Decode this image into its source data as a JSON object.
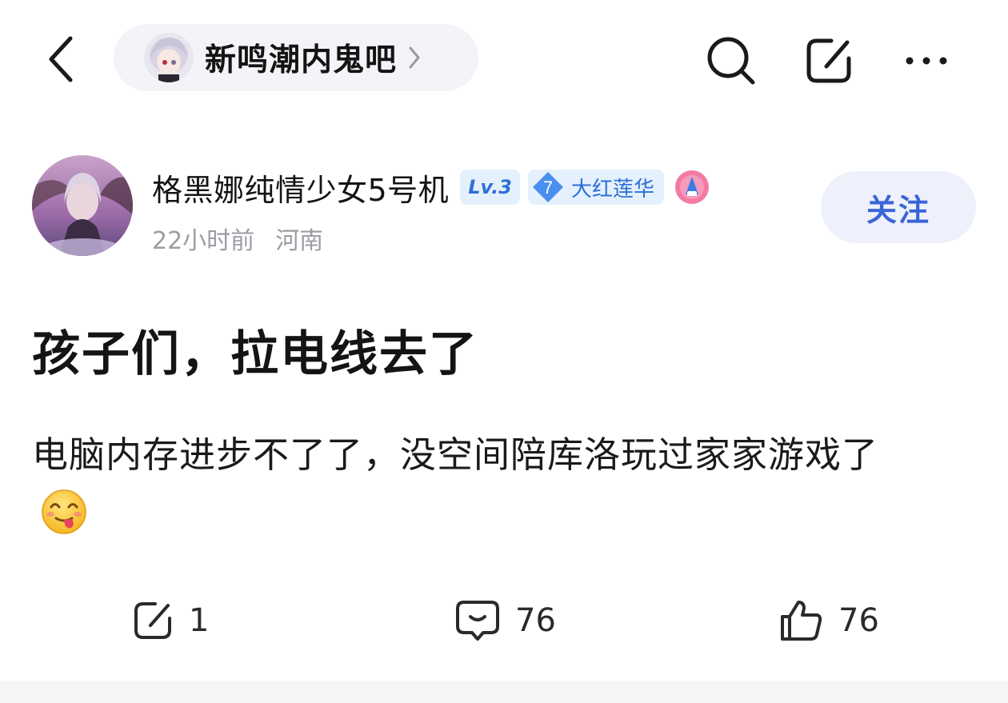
{
  "header": {
    "forum_name": "新鸣潮内鬼吧",
    "icons": [
      "back-arrow-icon",
      "search-icon",
      "share-icon",
      "more-icon"
    ]
  },
  "author": {
    "name": "格黑娜纯情少女5号机",
    "level": "Lv.3",
    "honor_level": "7",
    "honor_title": "大红莲华",
    "time": "22小时前",
    "location": "河南",
    "follow_label": "关注"
  },
  "post": {
    "title": "孩子们，拉电线去了",
    "body": "电脑内存进步不了了，没空间陪库洛玩过家家游戏了",
    "emoji": "tongue-out-emoji"
  },
  "actions": {
    "share_count": "1",
    "comment_count": "76",
    "like_count": "76"
  },
  "colors": {
    "accent": "#3a64d8",
    "badge_bg": "#e4f0fc",
    "pill_bg": "#f3f4f8",
    "meta": "#9c9ca4"
  }
}
